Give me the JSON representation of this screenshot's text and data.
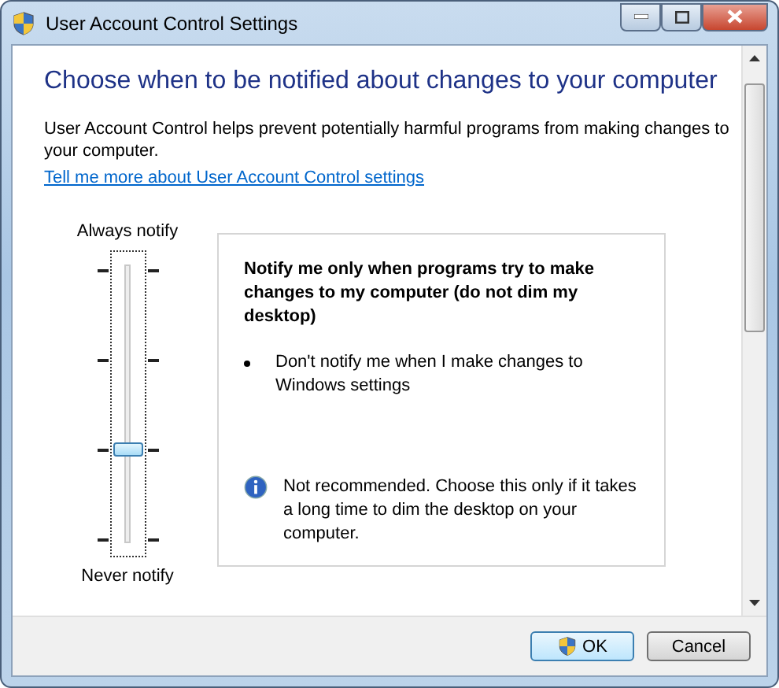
{
  "window": {
    "title": "User Account Control Settings"
  },
  "heading": "Choose when to be notified about changes to your computer",
  "description": "User Account Control helps prevent potentially harmful programs from making changes to your computer.",
  "link": "Tell me more about User Account Control settings",
  "slider": {
    "top_label": "Always notify",
    "bottom_label": "Never notify",
    "level": 0.333
  },
  "info": {
    "title": "Notify me only when programs try to make changes to my computer (do not dim my desktop)",
    "bullets": [
      "Don't notify me when I make changes to Windows settings"
    ],
    "note": "Not recommended. Choose this only if it takes a long time to dim the desktop on your computer."
  },
  "buttons": [
    {
      "label": "OK",
      "kind": "elevated"
    },
    {
      "label": "Cancel",
      "kind": "plain"
    }
  ]
}
